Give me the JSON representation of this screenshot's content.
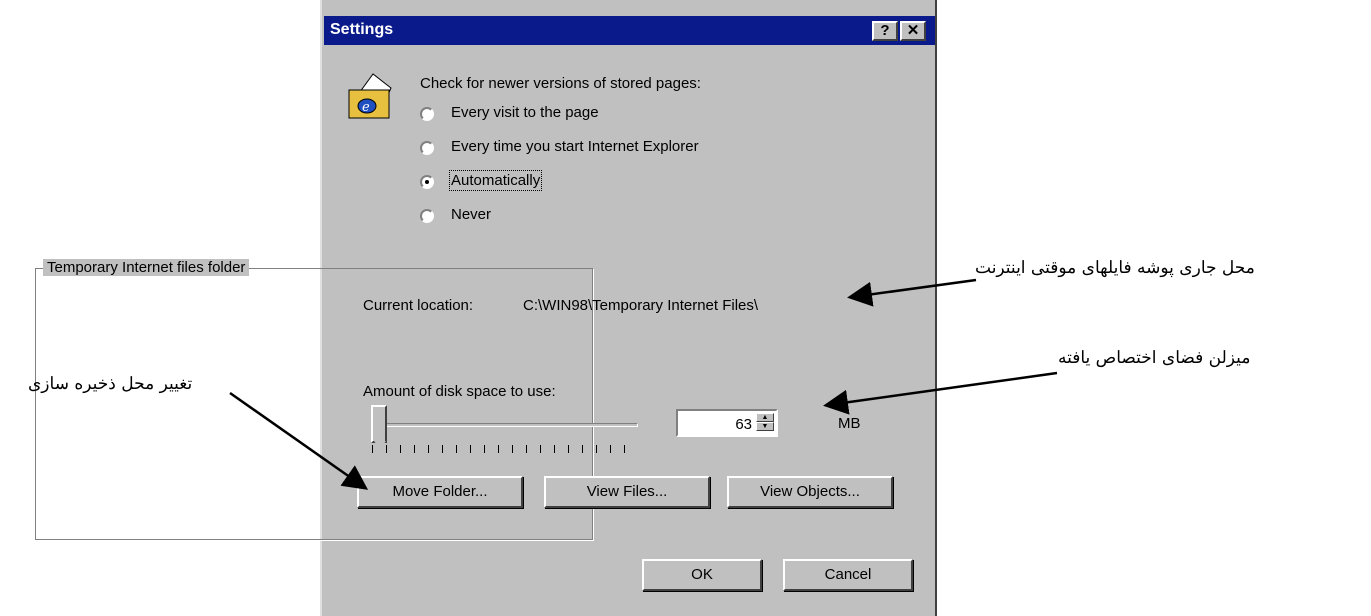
{
  "dialog": {
    "title": "Settings",
    "help_button": "?",
    "close_button": "✕",
    "check_heading": "Check for newer versions of stored pages:",
    "options": [
      {
        "label": "Every visit to the page",
        "selected": false
      },
      {
        "label": "Every time you start Internet Explorer",
        "selected": false
      },
      {
        "label": "Automatically",
        "selected": true
      },
      {
        "label": "Never",
        "selected": false
      }
    ],
    "group_title": "Temporary Internet files folder",
    "current_location_label": "Current location:",
    "current_location_value": "C:\\WIN98\\Temporary Internet Files\\",
    "disk_space_label": "Amount of disk space to use:",
    "disk_space_value": "63",
    "disk_space_unit": "MB",
    "move_folder": "Move Folder...",
    "view_files": "View Files...",
    "view_objects": "View Objects...",
    "ok": "OK",
    "cancel": "Cancel"
  },
  "annotations": {
    "location": "محل جاری پوشه فایلهای موقتی اینترنت",
    "space": "میزلن فضای اختصاص یافته",
    "move": "تغییر محل ذخیره سازی"
  }
}
